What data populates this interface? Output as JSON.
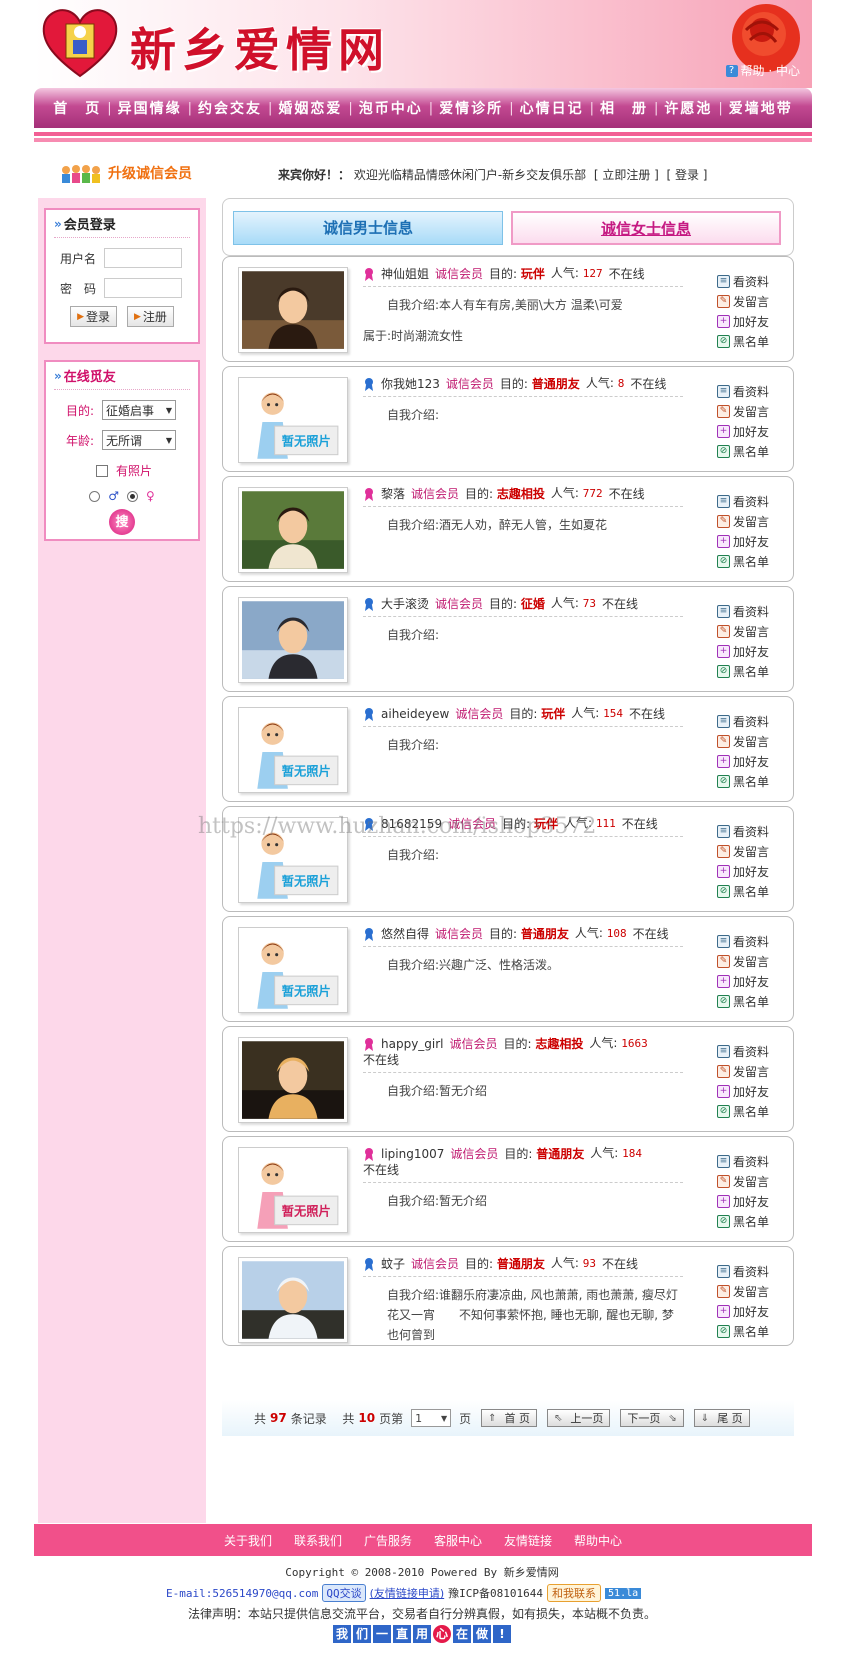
{
  "header": {
    "title": "新乡爱情网",
    "help": "帮助 · 中心"
  },
  "nav": [
    "首　页",
    "异国情缘",
    "约会交友",
    "婚姻恋爱",
    "泡币中心",
    "爱情诊所",
    "心情日记",
    "相　册",
    "许愿池",
    "爱墙地带"
  ],
  "upgrade_label": "升级诚信会员",
  "welcome": {
    "guest": "来宾你好！：",
    "text": "欢迎光临精品情感休闲门户-新乡交友俱乐部",
    "register": "立即注册",
    "login": "登录"
  },
  "login_box": {
    "title": "会员登录",
    "username_label": "用户名",
    "password_label": "密　码",
    "login_btn": "登录",
    "register_btn": "注册"
  },
  "online_box": {
    "title": "在线觅友",
    "goal_label": "目的:",
    "goal_value": "征婚启事",
    "age_label": "年龄:",
    "age_value": "无所谓",
    "photo_label": "有照片",
    "search_btn": "搜"
  },
  "tabs": {
    "male": "诚信男士信息",
    "female": "诚信女士信息"
  },
  "labels": {
    "vip": "诚信会员",
    "goal": "目的:",
    "pop": "人气:",
    "intro": "自我介绍:",
    "view": "看资料",
    "msg": "发留言",
    "friend": "加好友",
    "black": "黑名单"
  },
  "members": [
    {
      "name": "神仙姐姐",
      "goal": "玩伴",
      "pop": "127",
      "status": "不在线",
      "intro": "本人有车有房,美丽\\大方 温柔\\可爱",
      "belong": "属于:时尚潮流女性",
      "gender": "f",
      "photo": "real1"
    },
    {
      "name": "你我她123",
      "goal": "普通朋友",
      "pop": "8",
      "status": "不在线",
      "intro": "",
      "belong": "",
      "gender": "m",
      "photo": "none"
    },
    {
      "name": "黎落",
      "goal": "志趣相投",
      "pop": "772",
      "status": "不在线",
      "intro": "酒无人劝，醉无人管，生如夏花",
      "belong": "",
      "gender": "f",
      "photo": "real2"
    },
    {
      "name": "大手滚烫",
      "goal": "征婚",
      "pop": "73",
      "status": "不在线",
      "intro": "",
      "belong": "",
      "gender": "m",
      "photo": "real3"
    },
    {
      "name": "aiheideyew",
      "goal": "玩伴",
      "pop": "154",
      "status": "不在线",
      "intro": "",
      "belong": "",
      "gender": "m",
      "photo": "none"
    },
    {
      "name": "81682159",
      "goal": "玩伴",
      "pop": "111",
      "status": "不在线",
      "intro": "",
      "belong": "",
      "gender": "m",
      "photo": "none"
    },
    {
      "name": "悠然自得",
      "goal": "普通朋友",
      "pop": "108",
      "status": "不在线",
      "intro": "兴趣广泛、性格活泼。",
      "belong": "",
      "gender": "m",
      "photo": "none"
    },
    {
      "name": "happy_girl",
      "goal": "志趣相投",
      "pop": "1663",
      "status": "不在线",
      "intro": "暂无介绍",
      "belong": "",
      "gender": "f",
      "photo": "real4"
    },
    {
      "name": "liping1007",
      "goal": "普通朋友",
      "pop": "184",
      "status": "不在线",
      "intro": "暂无介绍",
      "belong": "",
      "gender": "f",
      "photo": "none-f"
    },
    {
      "name": "蚊子",
      "goal": "普通朋友",
      "pop": "93",
      "status": "不在线",
      "intro": "谁翻乐府凄凉曲, 风也萧萧, 雨也萧萧, 瘦尽灯花又一宵　　不知何事萦怀抱, 睡也无聊, 醒也无聊, 梦也何曾到",
      "belong": "",
      "gender": "m",
      "photo": "real5"
    }
  ],
  "no_photo_text": "暂无照片",
  "pager": {
    "total_prefix": "共",
    "total": "97",
    "total_suffix": "条记录",
    "pages_prefix": "共",
    "pages": "10",
    "pages_suffix": "页第",
    "current": "1",
    "page_word": "页",
    "first": "首 页",
    "prev": "上一页",
    "next": "下一页",
    "last": "尾 页"
  },
  "footer": {
    "links": [
      "关于我们",
      "联系我们",
      "广告服务",
      "客服中心",
      "友情链接",
      "帮助中心"
    ],
    "copyright": "Copyright © 2008-2010 Powered By 新乡爱情网",
    "email": "E-mail:526514970@qq.com",
    "qq": "QQ交谈",
    "link_apply": "(友情链接申请)",
    "icp": "豫ICP备08101644",
    "contact": "和我联系",
    "stat": "51.la",
    "legal": "法律声明：本站只提供信息交流平台，交易者自行分辨真假，如有损失，本站概不负责。",
    "slogan": [
      "我",
      "们",
      "一",
      "直",
      "用",
      "心",
      "在",
      "做",
      "!"
    ]
  },
  "watermark": "https://www.huzhan.com/ishop3572"
}
